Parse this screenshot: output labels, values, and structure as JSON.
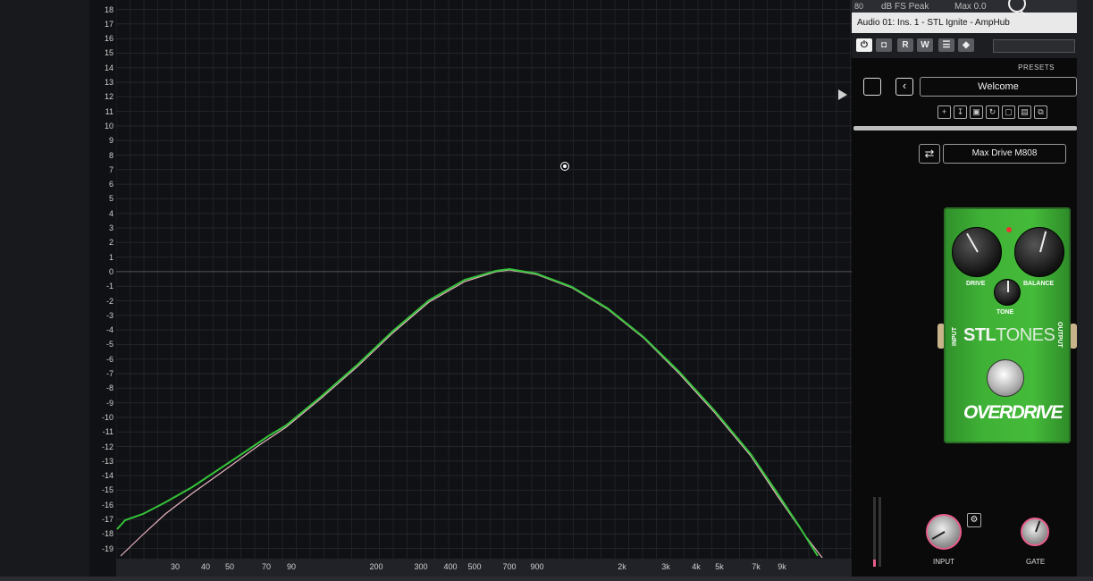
{
  "background_text": [
    "",
    "",
    "",
    ""
  ],
  "analyzer": {
    "y_ticks": [
      "18",
      "17",
      "16",
      "15",
      "14",
      "13",
      "12",
      "11",
      "10",
      "9",
      "8",
      "7",
      "6",
      "5",
      "4",
      "3",
      "2",
      "1",
      "0",
      "-1",
      "-2",
      "-3",
      "-4",
      "-5",
      "-6",
      "-7",
      "-8",
      "-9",
      "-10",
      "-11",
      "-12",
      "-13",
      "-14",
      "-15",
      "-16",
      "-17",
      "-18",
      "-19"
    ],
    "x_ticks": [
      "30",
      "40",
      "50",
      "70",
      "90",
      "200",
      "300",
      "400",
      "500",
      "700",
      "900",
      "2k",
      "3k",
      "4k",
      "5k",
      "7k",
      "9k"
    ],
    "curve_colors": {
      "primary": "#35c23a",
      "secondary": "#e8b4c0"
    }
  },
  "topstrip": {
    "left": "80",
    "dbfs": "dB FS Peak",
    "max": "Max 0.0"
  },
  "plugin": {
    "title": "Audio 01: Ins. 1 - STL Ignite - AmpHub",
    "host_buttons": [
      "⏻",
      "◘",
      "R",
      "W",
      "☰",
      "◆"
    ],
    "presets_label": "PRESETS",
    "preset_name": "Welcome",
    "model_name": "Max Drive M808",
    "pedal": {
      "knob_labels": [
        "DRIVE",
        "BALANCE",
        "TONE"
      ],
      "brand_bold": "STL",
      "brand_light": "TONES",
      "input_label": "INPUT",
      "output_label": "OUTPUT",
      "model_logo": "OVERDRIVE",
      "color": "#3fb136"
    },
    "bottom_knobs": [
      "INPUT",
      "GATE"
    ],
    "accent": "#e85d8a"
  },
  "icons": [
    "zoom-in-icon",
    "back-arrow-icon",
    "expand-icon",
    "settings-icon",
    "swap-icon",
    "play-icon"
  ]
}
